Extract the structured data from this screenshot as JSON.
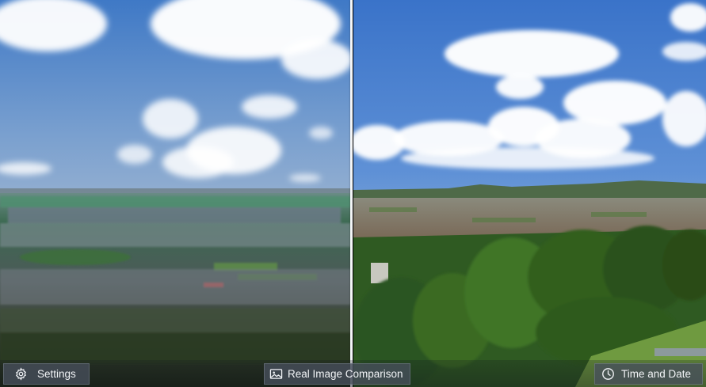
{
  "viewer": {
    "left_view": "rendered-terrain",
    "right_view": "real-photo"
  },
  "toolbar": {
    "settings": {
      "label": "Settings",
      "icon": "gear-icon"
    },
    "comparison": {
      "label": "Real Image Comparison",
      "icon": "image-icon"
    },
    "time": {
      "label": "Time and Date",
      "icon": "clock-icon"
    }
  },
  "colors": {
    "button_bg": "#48505C",
    "button_text": "#F2F4F7",
    "divider": "#F4F6F8",
    "sky_top": "#3E78C8",
    "sky_horizon": "#C9D3DE"
  }
}
